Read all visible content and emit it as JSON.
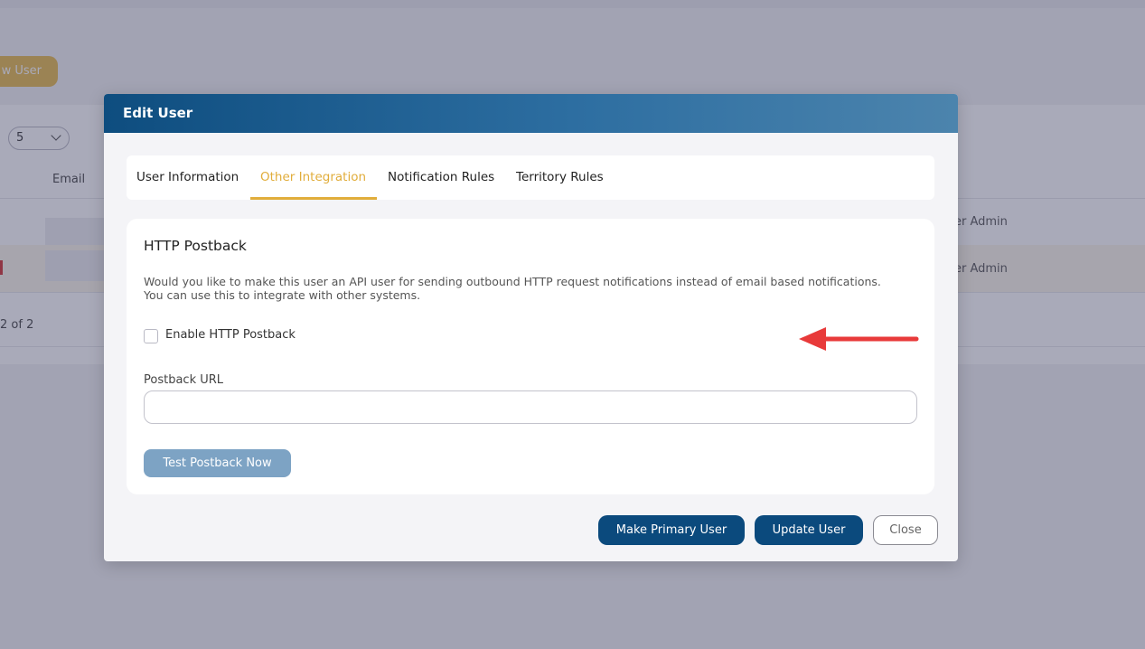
{
  "background": {
    "new_user_label": "w User",
    "page_size": "5",
    "email_header": "Email",
    "row1_role": "er Admin",
    "row2_role": "er Admin",
    "count_text": "2 of 2"
  },
  "modal": {
    "title": "Edit User",
    "tabs": [
      {
        "label": "User Information",
        "active": false
      },
      {
        "label": "Other Integration",
        "active": true
      },
      {
        "label": "Notification Rules",
        "active": false
      },
      {
        "label": "Territory Rules",
        "active": false
      }
    ],
    "section": {
      "title": "HTTP Postback",
      "description": "Would you like to make this user an API user for sending outbound HTTP request notifications instead of email based notifications. You can use this to integrate with other systems.",
      "checkbox_label": "Enable HTTP Postback",
      "checkbox_checked": false,
      "url_label": "Postback URL",
      "url_value": "",
      "test_button": "Test Postback Now"
    },
    "footer": {
      "make_primary": "Make Primary User",
      "update": "Update User",
      "close": "Close"
    }
  },
  "colors": {
    "accent": "#e1ad3b",
    "primary": "#0b4a7d",
    "annotation_arrow": "#e83a3a"
  },
  "annotation": {
    "icon": "red-arrow-left-icon"
  }
}
